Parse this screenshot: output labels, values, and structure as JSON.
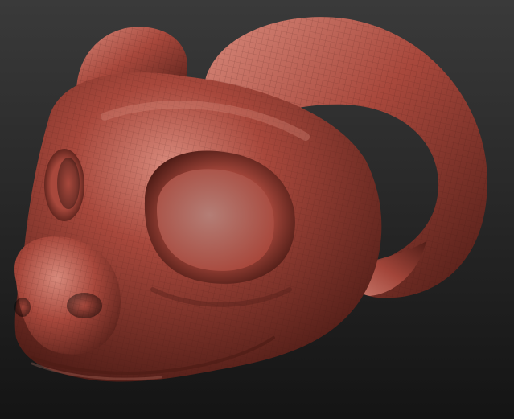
{
  "viewport": {
    "background_top": "#3a3a3a",
    "background_bottom": "#141414",
    "subject": "sculpted-ram-head-mask"
  },
  "model": {
    "base_color": "#a8483c",
    "shadow_color": "#4e1c16",
    "highlight_color": "#d88a7c",
    "eye_color": "#b47e76",
    "wireframe_color": "#3a1410"
  }
}
